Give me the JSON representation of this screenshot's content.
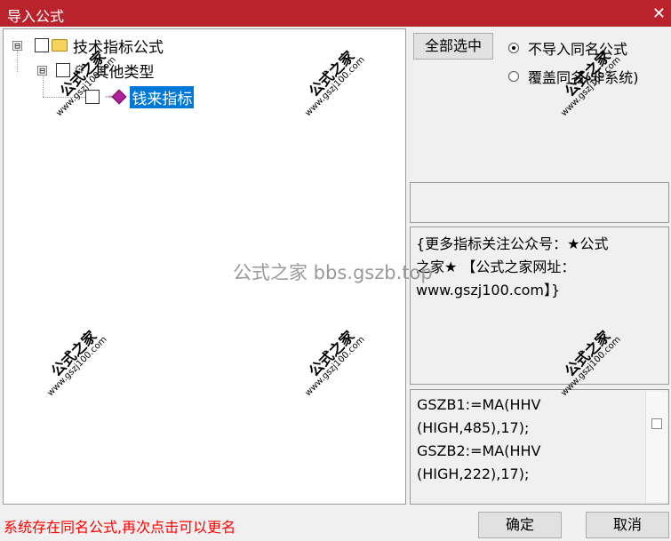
{
  "window": {
    "title": "导入公式",
    "close_glyph": "✕"
  },
  "tree": {
    "root": {
      "expander": "⊟",
      "label": "技术指标公式"
    },
    "group": {
      "expander": "⊟",
      "label": "其他类型"
    },
    "leaf": {
      "label": "钱来指标"
    }
  },
  "buttons": {
    "select_all": "全部选中",
    "ok": "确定",
    "cancel": "取消"
  },
  "options": {
    "no_import_same_name": "不导入同名公式",
    "overwrite_same_name": "覆盖同名(非系统)"
  },
  "note": {
    "line1": "{更多指标关注公众号：★公式",
    "line2": "之家★ 【公式之家网址：",
    "line3": "www.gszj100.com】}"
  },
  "code": {
    "text": "GSZB1:=MA(HHV\n(HIGH,485),17);\nGSZB2:=MA(HHV\n(HIGH,222),17);"
  },
  "status_text": "系统存在同名公式,再次点击可以更名",
  "watermarks": {
    "stamp": "公式之家",
    "url": "www.gszj100.com",
    "center": "公式之家 bbs.gszb.top"
  },
  "colors": {
    "titlebar": "#b8232c",
    "selection": "#0078d7",
    "status": "#ff0000"
  }
}
